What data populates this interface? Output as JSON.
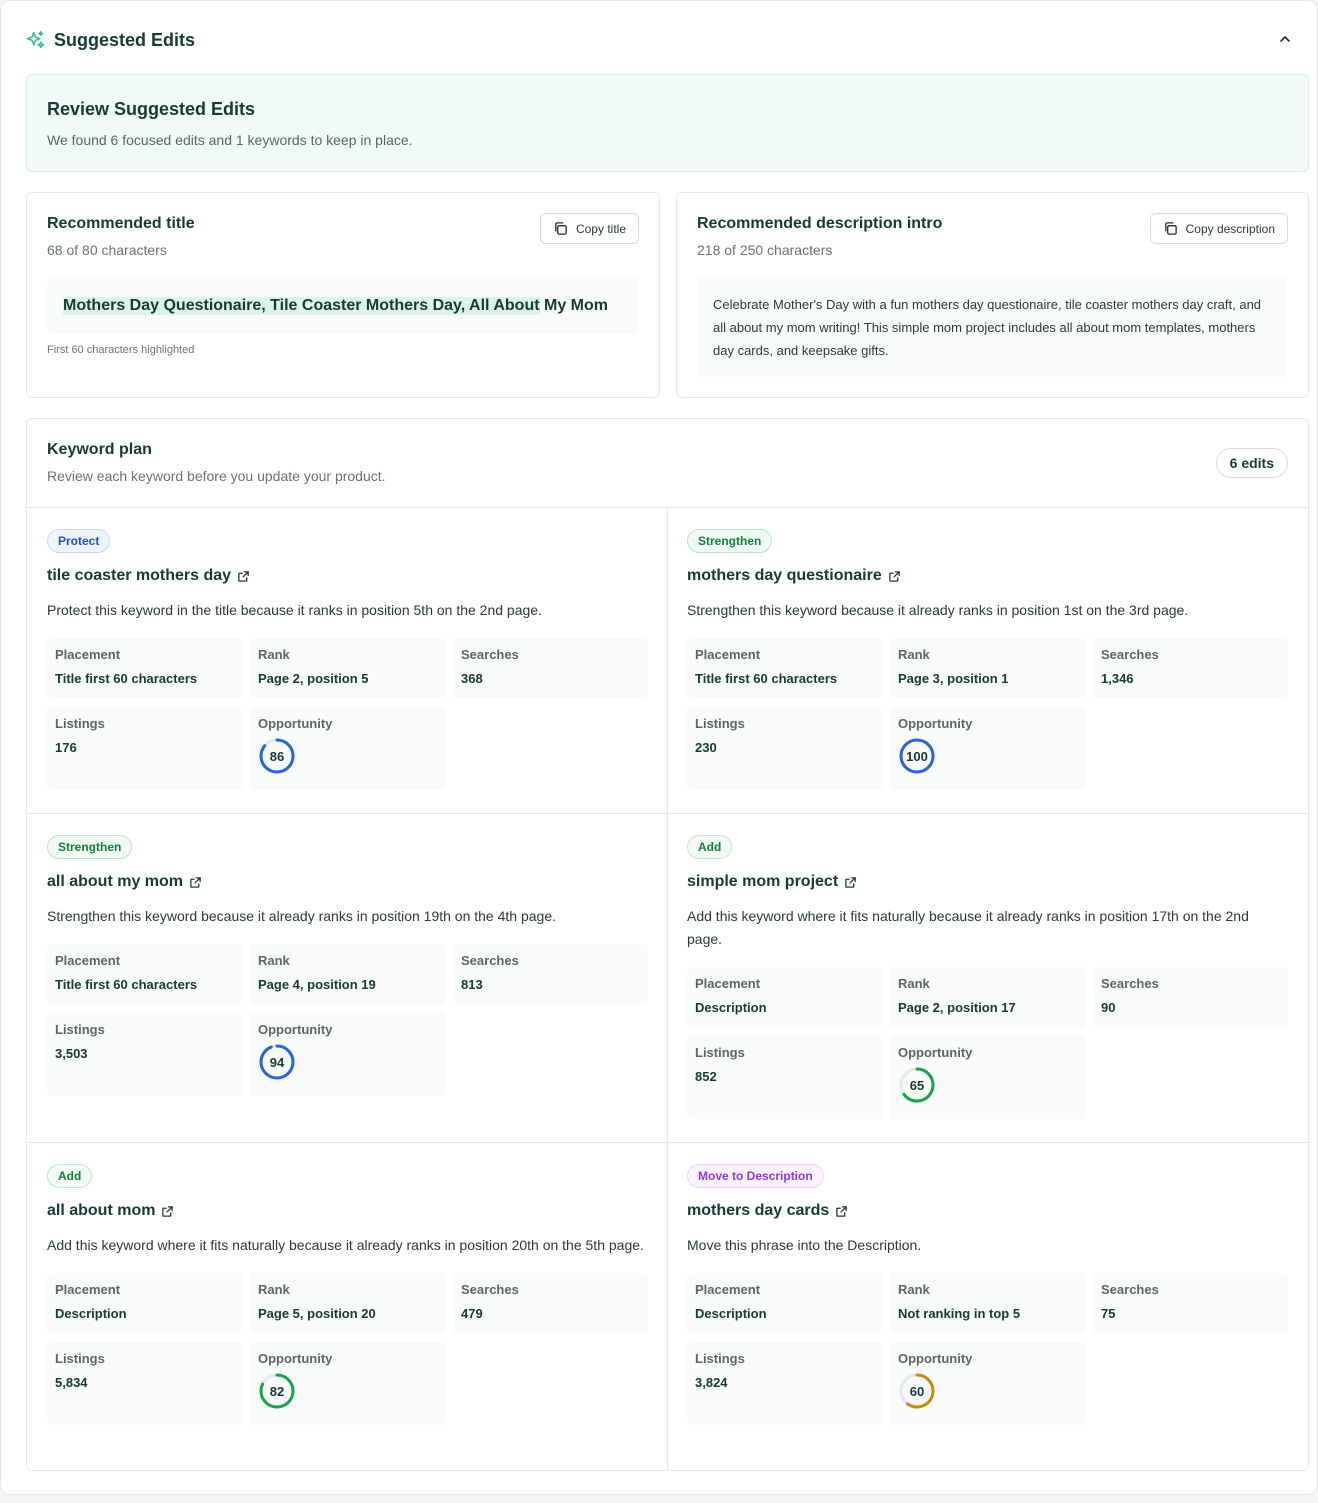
{
  "header": {
    "title": "Suggested Edits",
    "icon": "sparkle-icon",
    "collapse_icon": "chevron-up-icon"
  },
  "review": {
    "title": "Review Suggested Edits",
    "subtitle": "We found 6 focused edits and 1 keywords to keep in place."
  },
  "title_card": {
    "heading": "Recommended title",
    "count": "68 of 80 characters",
    "copy_label": "Copy title",
    "highlighted": "Mothers Day Questionaire, Tile Coaster Mothers Day, All About",
    "rest": " My Mom",
    "note": "First 60 characters highlighted"
  },
  "desc_card": {
    "heading": "Recommended description intro",
    "count": "218 of 250 characters",
    "copy_label": "Copy description",
    "text": "Celebrate Mother's Day with a fun mothers day questionaire, tile coaster mothers day craft, and all about my mom writing! This simple mom project includes all about mom templates, mothers day cards, and keepsake gifts."
  },
  "keyword_plan": {
    "title": "Keyword plan",
    "subtitle": "Review each keyword before you update your product.",
    "edits_label": "6 edits",
    "labels": {
      "placement": "Placement",
      "rank": "Rank",
      "searches": "Searches",
      "listings": "Listings",
      "opportunity": "Opportunity"
    },
    "keywords": [
      {
        "badge": "Protect",
        "name": "tile coaster mothers day",
        "desc": "Protect this keyword in the title because it ranks in position 5th on the 2nd page.",
        "placement": "Title first 60 characters",
        "rank": "Page 2, position 5",
        "searches": "368",
        "listings": "176",
        "opportunity": 86,
        "ring_color": "#2563eb"
      },
      {
        "badge": "Strengthen",
        "name": "mothers day questionaire",
        "desc": "Strengthen this keyword because it already ranks in position 1st on the 3rd page.",
        "placement": "Title first 60 characters",
        "rank": "Page 3, position 1",
        "searches": "1,346",
        "listings": "230",
        "opportunity": 100,
        "ring_color": "#2563eb"
      },
      {
        "badge": "Strengthen",
        "name": "all about my mom",
        "desc": "Strengthen this keyword because it already ranks in position 19th on the 4th page.",
        "placement": "Title first 60 characters",
        "rank": "Page 4, position 19",
        "searches": "813",
        "listings": "3,503",
        "opportunity": 94,
        "ring_color": "#2563eb"
      },
      {
        "badge": "Add",
        "name": "simple mom project",
        "desc": "Add this keyword where it fits naturally because it already ranks in position 17th on the 2nd page.",
        "placement": "Description",
        "rank": "Page 2, position 17",
        "searches": "90",
        "listings": "852",
        "opportunity": 65,
        "ring_color": "#16a34a"
      },
      {
        "badge": "Add",
        "name": "all about mom",
        "desc": "Add this keyword where it fits naturally because it already ranks in position 20th on the 5th page.",
        "placement": "Description",
        "rank": "Page 5, position 20",
        "searches": "479",
        "listings": "5,834",
        "opportunity": 82,
        "ring_color": "#16a34a"
      },
      {
        "badge": "Move to Description",
        "name": "mothers day cards",
        "desc": "Move this phrase into the Description.",
        "placement": "Description",
        "rank": "Not ranking in top 5",
        "searches": "75",
        "listings": "3,824",
        "opportunity": 60,
        "ring_color": "#ca8a04"
      }
    ]
  }
}
